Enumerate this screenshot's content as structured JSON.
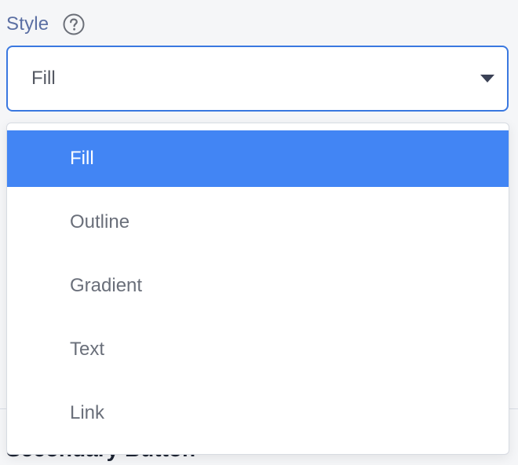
{
  "field": {
    "label": "Style",
    "help_icon": "question-circle-icon",
    "selected_value": "Fill"
  },
  "dropdown": {
    "options": [
      "Fill",
      "Outline",
      "Gradient",
      "Text",
      "Link"
    ],
    "selected_index": 0
  },
  "below": {
    "heading": "Secondary Button"
  },
  "colors": {
    "label": "#5b6fa3",
    "focus_border": "#3a78e0",
    "selected_bg": "#4285f4",
    "option_text": "#6a6f7a"
  }
}
